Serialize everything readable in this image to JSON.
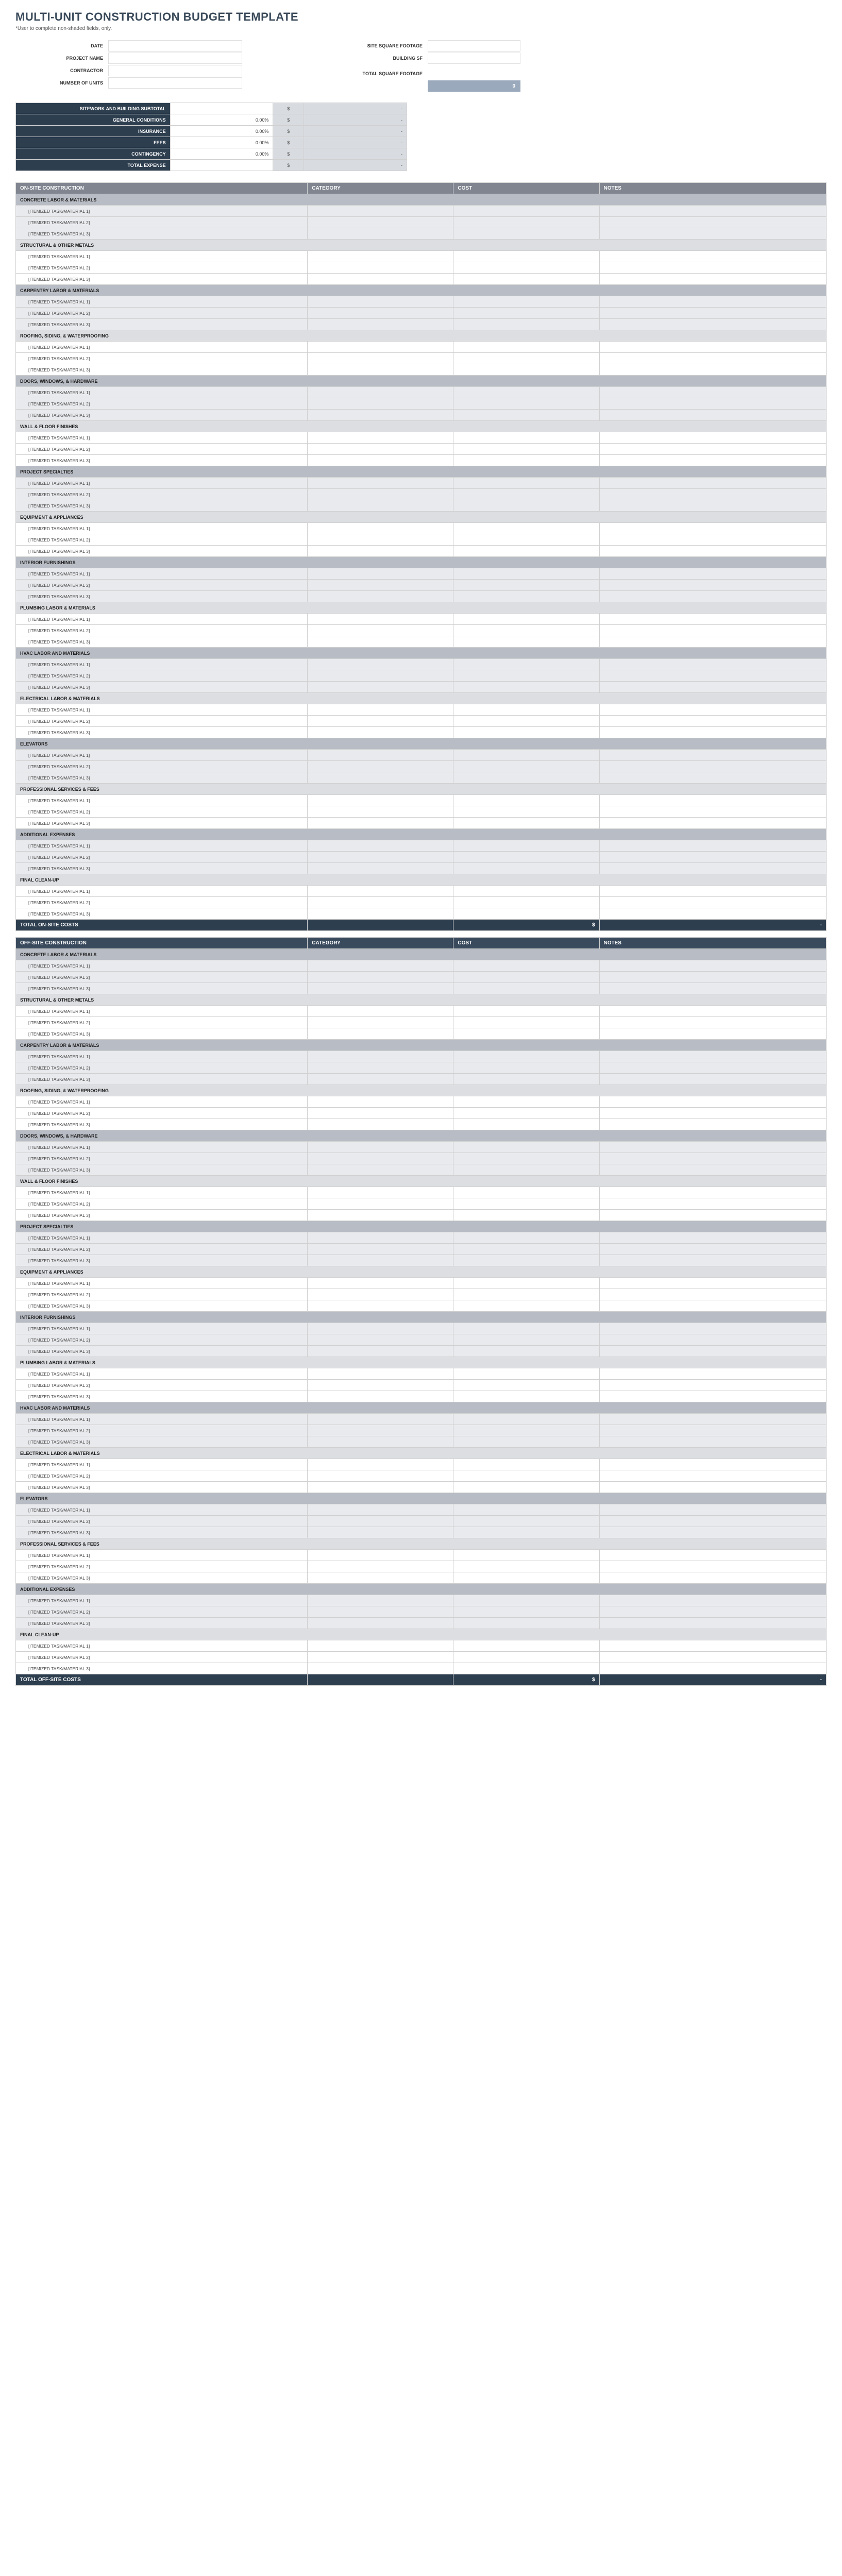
{
  "title": "MULTI-UNIT CONSTRUCTION BUDGET TEMPLATE",
  "subtitle": "*User to complete non-shaded fields, only.",
  "info_left": [
    {
      "label": "DATE"
    },
    {
      "label": "PROJECT NAME"
    },
    {
      "label": "CONTRACTOR"
    },
    {
      "label": "NUMBER OF UNITS"
    }
  ],
  "info_right": [
    {
      "label": "SITE SQUARE FOOTAGE"
    },
    {
      "label": "BUILDING SF"
    },
    {
      "label": "TOTAL SQUARE FOOTAGE"
    }
  ],
  "sf_total": "0",
  "summary_rows": [
    {
      "label": "SITEWORK AND BUILDING SUBTOTAL",
      "pct": "",
      "dollar": "$",
      "val": "-"
    },
    {
      "label": "GENERAL CONDITIONS",
      "pct": "0.00%",
      "dollar": "$",
      "val": "-"
    },
    {
      "label": "INSURANCE",
      "pct": "0.00%",
      "dollar": "$",
      "val": "-"
    },
    {
      "label": "FEES",
      "pct": "0.00%",
      "dollar": "$",
      "val": "-"
    },
    {
      "label": "CONTINGENCY",
      "pct": "0.00%",
      "dollar": "$",
      "val": "-"
    },
    {
      "label": "TOTAL EXPENSE",
      "pct": "",
      "dollar": "$",
      "val": "-"
    }
  ],
  "col_headers": [
    "CATEGORY",
    "COST",
    "NOTES"
  ],
  "item_template": [
    "[ITEMIZED TASK/MATERIAL 1]",
    "[ITEMIZED TASK/MATERIAL 2]",
    "[ITEMIZED TASK/MATERIAL 3]"
  ],
  "sections": [
    {
      "header": "ON-SITE CONSTRUCTION",
      "header_style": "grey",
      "total_label": "TOTAL ON-SITE COSTS",
      "categories": [
        {
          "name": "CONCRETE LABOR & MATERIALS",
          "shaded": true
        },
        {
          "name": "STRUCTURAL & OTHER METALS",
          "shaded": false
        },
        {
          "name": "CARPENTRY LABOR & MATERIALS",
          "shaded": true
        },
        {
          "name": "ROOFING, SIDING, & WATERPROOFING",
          "shaded": false
        },
        {
          "name": "DOORS, WINDOWS, & HARDWARE",
          "shaded": true
        },
        {
          "name": "WALL & FLOOR FINISHES",
          "shaded": false
        },
        {
          "name": "PROJECT SPECIALTIES",
          "shaded": true
        },
        {
          "name": "EQUIPMENT & APPLIANCES",
          "shaded": false
        },
        {
          "name": "INTERIOR FURNISHINGS",
          "shaded": true
        },
        {
          "name": "PLUMBING LABOR & MATERIALS",
          "shaded": false
        },
        {
          "name": "HVAC LABOR AND MATERIALS",
          "shaded": true
        },
        {
          "name": "ELECTRICAL LABOR & MATERIALS",
          "shaded": false
        },
        {
          "name": "ELEVATORS",
          "shaded": true
        },
        {
          "name": "PROFESSIONAL SERVICES & FEES",
          "shaded": false
        },
        {
          "name": "ADDITIONAL EXPENSES",
          "shaded": true
        },
        {
          "name": "FINAL CLEAN-UP",
          "shaded": false
        }
      ]
    },
    {
      "header": "OFF-SITE CONSTRUCTION",
      "header_style": "blue",
      "total_label": "TOTAL OFF-SITE COSTS",
      "categories": [
        {
          "name": "CONCRETE LABOR & MATERIALS",
          "shaded": true
        },
        {
          "name": "STRUCTURAL & OTHER METALS",
          "shaded": false
        },
        {
          "name": "CARPENTRY LABOR & MATERIALS",
          "shaded": true
        },
        {
          "name": "ROOFING, SIDING, & WATERPROOFING",
          "shaded": false
        },
        {
          "name": "DOORS, WINDOWS, & HARDWARE",
          "shaded": true
        },
        {
          "name": "WALL & FLOOR FINISHES",
          "shaded": false
        },
        {
          "name": "PROJECT SPECIALTIES",
          "shaded": true
        },
        {
          "name": "EQUIPMENT & APPLIANCES",
          "shaded": false
        },
        {
          "name": "INTERIOR FURNISHINGS",
          "shaded": true
        },
        {
          "name": "PLUMBING LABOR & MATERIALS",
          "shaded": false
        },
        {
          "name": "HVAC LABOR AND MATERIALS",
          "shaded": true
        },
        {
          "name": "ELECTRICAL LABOR & MATERIALS",
          "shaded": false
        },
        {
          "name": "ELEVATORS",
          "shaded": true
        },
        {
          "name": "PROFESSIONAL SERVICES & FEES",
          "shaded": false
        },
        {
          "name": "ADDITIONAL EXPENSES",
          "shaded": true
        },
        {
          "name": "FINAL CLEAN-UP",
          "shaded": false
        }
      ]
    }
  ],
  "total_currency": "$",
  "total_value": "-"
}
